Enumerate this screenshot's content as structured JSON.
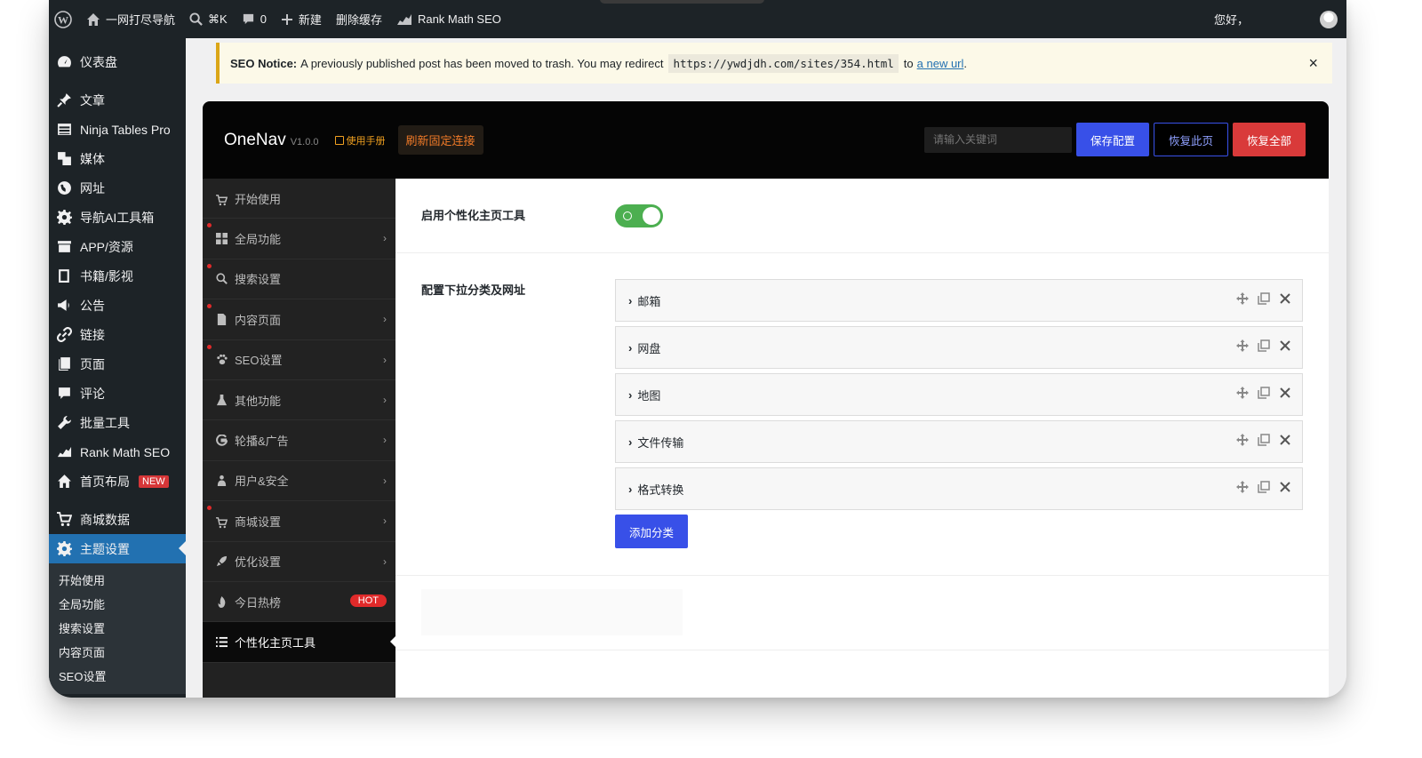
{
  "adminbar": {
    "site_name": "一网打尽导航",
    "search_shortcut": "⌘K",
    "comments_count": "0",
    "new_label": "新建",
    "clear_cache": "删除缓存",
    "rank_math": "Rank Math SEO",
    "greeting": "您好，"
  },
  "wp_menu": {
    "items": [
      {
        "label": "仪表盘",
        "icon": "dashboard-icon"
      },
      {
        "label": "文章",
        "icon": "pin-icon"
      },
      {
        "label": "Ninja Tables Pro",
        "icon": "table-icon"
      },
      {
        "label": "媒体",
        "icon": "media-icon"
      },
      {
        "label": "网址",
        "icon": "globe-icon"
      },
      {
        "label": "导航AI工具箱",
        "icon": "gear-icon"
      },
      {
        "label": "APP/资源",
        "icon": "archive-icon"
      },
      {
        "label": "书籍/影视",
        "icon": "book-icon"
      },
      {
        "label": "公告",
        "icon": "megaphone-icon"
      },
      {
        "label": "链接",
        "icon": "link-icon"
      },
      {
        "label": "页面",
        "icon": "page-icon"
      },
      {
        "label": "评论",
        "icon": "comment-icon"
      },
      {
        "label": "批量工具",
        "icon": "wrench-icon"
      },
      {
        "label": "Rank Math SEO",
        "icon": "chart-icon"
      },
      {
        "label": "首页布局",
        "icon": "home-icon",
        "badge": "NEW"
      },
      {
        "label": "商城数据",
        "icon": "cart-icon"
      },
      {
        "label": "主题设置",
        "icon": "gear-icon",
        "active": true
      }
    ],
    "submenu": [
      "开始使用",
      "全局功能",
      "搜索设置",
      "内容页面",
      "SEO设置"
    ]
  },
  "notice": {
    "strong": "SEO Notice:",
    "text": "A previously published post has been moved to trash. You may redirect",
    "url": "https://ywdjdh.com/sites/354.html",
    "to": "to",
    "link": "a new url",
    "period": ".",
    "close": "×"
  },
  "panel": {
    "brand": "OneNav",
    "version": "V1.0.0",
    "manual": "使用手册",
    "refresh": "刷新固定连接",
    "search_placeholder": "请输入关键词",
    "save": "保存配置",
    "restore_page": "恢复此页",
    "restore_all": "恢复全部"
  },
  "options_nav": [
    {
      "label": "开始使用",
      "icon": "cart-icon",
      "dot": false,
      "chevron": false
    },
    {
      "label": "全局功能",
      "icon": "grid-icon",
      "dot": true,
      "chevron": true
    },
    {
      "label": "搜索设置",
      "icon": "search-icon",
      "dot": true,
      "chevron": false
    },
    {
      "label": "内容页面",
      "icon": "file-icon",
      "dot": true,
      "chevron": true
    },
    {
      "label": "SEO设置",
      "icon": "paw-icon",
      "dot": true,
      "chevron": true
    },
    {
      "label": "其他功能",
      "icon": "flask-icon",
      "dot": false,
      "chevron": true
    },
    {
      "label": "轮播&广告",
      "icon": "g-icon",
      "dot": false,
      "chevron": true
    },
    {
      "label": "用户&安全",
      "icon": "user-icon",
      "dot": false,
      "chevron": true
    },
    {
      "label": "商城设置",
      "icon": "cart-icon",
      "dot": true,
      "chevron": true
    },
    {
      "label": "优化设置",
      "icon": "rocket-icon",
      "dot": false,
      "chevron": true
    },
    {
      "label": "今日热榜",
      "icon": "fire-icon",
      "dot": false,
      "chevron": false,
      "badge": "HOT"
    },
    {
      "label": "个性化主页工具",
      "icon": "list-icon",
      "dot": false,
      "chevron": false,
      "active": true
    }
  ],
  "main": {
    "enable_label": "启用个性化主页工具",
    "config_label": "配置下拉分类及网址",
    "groups": [
      "邮箱",
      "网盘",
      "地图",
      "文件传输",
      "格式转换"
    ],
    "add_button": "添加分类"
  }
}
